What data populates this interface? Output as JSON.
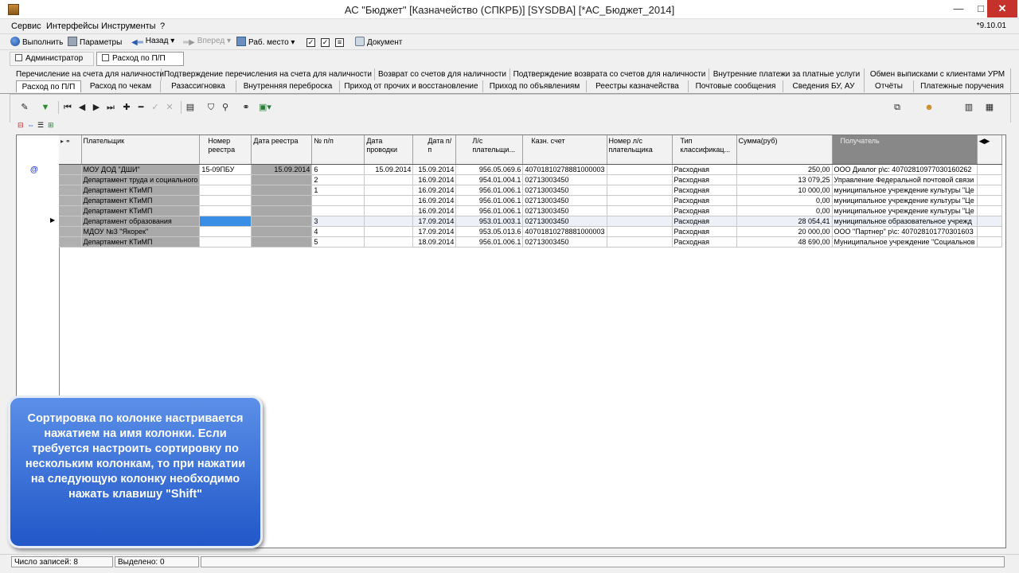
{
  "window": {
    "title": "АС \"Бюджет\" [Казначейство (СПКРБ)] [SYSDBA] [*АС_Бюджет_2014]",
    "minimize": "—",
    "maximize": "□",
    "close": "✕"
  },
  "menu": {
    "items": [
      "Сервис",
      "Интерфейсы",
      "Инструменты",
      "?"
    ],
    "version": "*9.10.01"
  },
  "toolbar": {
    "run": "Выполнить",
    "params": "Параметры",
    "back": "Назад",
    "forward": "Вперед",
    "workplace": "Раб. место",
    "document": "Документ"
  },
  "doc_tabs": [
    "Администратор",
    "Расход по П/П"
  ],
  "module_tabs": {
    "row1": [
      "Перечисление на счета для наличности",
      "Подтверждение перечисления на счета для наличности",
      "Возврат со счетов для наличности",
      "Подтверждение возврата со счетов для наличности",
      "Внутренние платежи за платные услуги",
      "Обмен выписками с клиентами УРМ"
    ],
    "row2": [
      "Расход по П/П",
      "Расход по чекам",
      "Разассигновка",
      "Внутренняя переброска",
      "Приход от прочих и восстановление",
      "Приход по объявлениям",
      "Реестры казначейства",
      "Почтовые сообщения",
      "Сведения БУ, АУ",
      "Отчёты",
      "Платежные поручения"
    ],
    "active": "Расход по П/П"
  },
  "grid": {
    "marker": "@",
    "columns": [
      "Плательщик",
      "Номер реестра",
      "Дата реестра",
      "№ п/п",
      "Дата проводки",
      "Дата п/п",
      "Л/с плательщи...",
      "Казн. счет",
      "Номер л/с плательщика",
      "Тип классификац...",
      "Сумма(руб)",
      "Получатель"
    ],
    "rows": [
      [
        "МОУ ДОД \"ДШИ\"",
        "15-09ПБУ",
        "15.09.2014",
        "6",
        "15.09.2014",
        "15.09.2014",
        "956.05.069.6",
        "40701810278881000003",
        "",
        "Расходная",
        "250,00",
        "ООО Диалог р\\с: 40702810977030160262"
      ],
      [
        "Департамент труда и социального",
        "",
        "",
        "2",
        "",
        "16.09.2014",
        "954.01.004.1",
        "02713003450",
        "",
        "Расходная",
        "13 079,25",
        "Управление Федеральной почтовой связи"
      ],
      [
        "Департамент КТиМП",
        "",
        "",
        "1",
        "",
        "16.09.2014",
        "956.01.006.1",
        "02713003450",
        "",
        "Расходная",
        "10 000,00",
        "муниципальное учреждение культуры \"Це"
      ],
      [
        "Департамент КТиМП",
        "",
        "",
        "",
        "",
        "16.09.2014",
        "956.01.006.1",
        "02713003450",
        "",
        "Расходная",
        "0,00",
        "муниципальное учреждение культуры \"Це"
      ],
      [
        "Департамент КТиМП",
        "",
        "",
        "",
        "",
        "16.09.2014",
        "956.01.006.1",
        "02713003450",
        "",
        "Расходная",
        "0,00",
        "муниципальное учреждение культуры \"Це"
      ],
      [
        "Департамент образования",
        "",
        "",
        "3",
        "",
        "17.09.2014",
        "953.01.003.1",
        "02713003450",
        "",
        "Расходная",
        "28 054,41",
        "муниципальное образовательное учрежд"
      ],
      [
        "МДОУ №3 \"Якорек\"",
        "",
        "",
        "4",
        "",
        "17.09.2014",
        "953.05.013.6",
        "40701810278881000003",
        "",
        "Расходная",
        "20 000,00",
        "ООО \"Партнер\" р\\с: 40702810177030160З"
      ],
      [
        "Департамент КТиМП",
        "",
        "",
        "5",
        "",
        "18.09.2014",
        "956.01.006.1",
        "02713003450",
        "",
        "Расходная",
        "48 690,00",
        "Муниципальное учреждение \"Социальнов"
      ]
    ]
  },
  "callout": {
    "text": "Сортировка по колонке настривается нажатием на имя колонки. Если  требуется настроить сортировку по нескольким колонкам, то при нажатии на следующую колонку необходимо нажать клавишу \"Shift\""
  },
  "status": {
    "records_label": "Число записей:",
    "records_value": "8",
    "selected_label": "Выделено:",
    "selected_value": "0"
  }
}
